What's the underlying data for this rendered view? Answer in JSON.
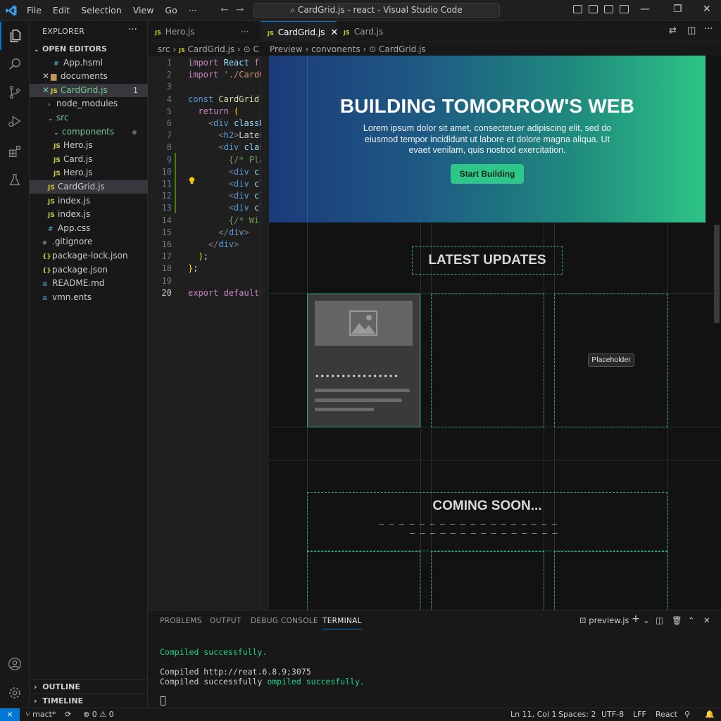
{
  "window": {
    "title": "CardGrid.js - react - Visual Studio Code",
    "menu": [
      "File",
      "Edit",
      "Selection",
      "View",
      "Go",
      "···"
    ]
  },
  "sidebar": {
    "title": "EXPLORER",
    "more": "···",
    "open_editors_label": "OPEN EDITORS",
    "rows": [
      {
        "label": "App.hsml",
        "kind": "css",
        "depth": 2
      },
      {
        "label": "documents",
        "kind": "folder",
        "depth": 1,
        "close": true
      },
      {
        "label": "CardGrid.js",
        "kind": "js",
        "depth": 1,
        "close": true,
        "selected": true,
        "badge": "1",
        "green": true
      },
      {
        "label": "node_modules",
        "kind": "chev",
        "depth": 1
      },
      {
        "label": "src",
        "kind": "chev-open",
        "depth": 1,
        "green": true
      },
      {
        "label": "components",
        "kind": "chev-open",
        "depth": 2,
        "green": true,
        "dot": true
      },
      {
        "label": "Hero.js",
        "kind": "js",
        "depth": 2
      },
      {
        "label": "Card.js",
        "kind": "js",
        "depth": 2
      },
      {
        "label": "Hero.js",
        "kind": "js",
        "depth": 2
      },
      {
        "label": "CardGrid.js",
        "kind": "js",
        "depth": 1,
        "selected": true
      },
      {
        "label": "index.js",
        "kind": "js",
        "depth": 1
      },
      {
        "label": "index.js",
        "kind": "js",
        "depth": 1
      },
      {
        "label": "App.css",
        "kind": "css",
        "depth": 1
      },
      {
        "label": ".gitignore",
        "kind": "git",
        "depth": 0
      },
      {
        "label": "package-lock.json",
        "kind": "json",
        "depth": 0
      },
      {
        "label": "package.json",
        "kind": "json",
        "depth": 0
      },
      {
        "label": "README.md",
        "kind": "md",
        "depth": 0
      },
      {
        "label": "vmn.ents",
        "kind": "md",
        "depth": 0
      }
    ],
    "outline_label": "OUTLINE",
    "timeline_label": "TIMELINE"
  },
  "editor": {
    "left_tab": "Hero.js",
    "left_more": "···",
    "tabs": [
      "CardGrid.js",
      "Card.js"
    ],
    "breadcrumb_left": [
      "src",
      "CardGrid.js",
      "C"
    ],
    "breadcrumb_right": [
      "Preview",
      "convonents",
      "CardGrid.js"
    ],
    "code": [
      {
        "n": "1",
        "html": "<span class='ctl'>import</span> <span class='attr'>React</span> <span class='ctl'>fr</span>"
      },
      {
        "n": "2",
        "html": "<span class='ctl'>import</span> <span class='str'>'./CardG</span>"
      },
      {
        "n": "3",
        "html": ""
      },
      {
        "n": "4",
        "html": "<span class='kw'>const</span> <span class='fn'>CardGrid</span>"
      },
      {
        "n": "5",
        "html": "  <span class='ctl'>return</span> <span class='br'>(</span>"
      },
      {
        "n": "6",
        "html": "    <span class='pn'>&lt;</span><span class='tag'>div</span> <span class='attr'>classN</span>"
      },
      {
        "n": "7",
        "html": "      <span class='pn'>&lt;</span><span class='tag'>h2</span><span class='pn'>&gt;</span><span class='pl'>Latest</span>"
      },
      {
        "n": "8",
        "html": "      <span class='pn'>&lt;</span><span class='tag'>div</span> <span class='attr'>class</span>"
      },
      {
        "n": "9",
        "html": "        <span class='cm'>{/* Plac</span>"
      },
      {
        "n": "10",
        "html": "        <span class='pn'>&lt;</span><span class='tag'>div</span> <span class='attr'>cla</span>"
      },
      {
        "n": "11",
        "html": "        <span class='pn'>&lt;</span><span class='tag'>div</span> <span class='attr'>cla</span>"
      },
      {
        "n": "12",
        "html": "        <span class='pn'>&lt;</span><span class='tag'>div</span> <span class='attr'>cla</span>"
      },
      {
        "n": "13",
        "html": "        <span class='pn'>&lt;</span><span class='tag'>div</span> <span class='attr'>cla</span>"
      },
      {
        "n": "14",
        "html": "        <span class='cm'>{/* Wire</span>"
      },
      {
        "n": "15",
        "html": "      <span class='pn'>&lt;/</span><span class='tag'>div</span><span class='pn'>&gt;</span>"
      },
      {
        "n": "16",
        "html": "    <span class='pn'>&lt;/</span><span class='tag'>div</span><span class='pn'>&gt;</span>"
      },
      {
        "n": "17",
        "html": "  <span class='br'>)</span><span class='pl'>;</span>"
      },
      {
        "n": "18",
        "html": "<span class='br'>}</span><span class='pl'>;</span>"
      },
      {
        "n": "19",
        "html": ""
      },
      {
        "n": "20",
        "html": "<span class='ctl'>export</span> <span class='ctl'>default</span>"
      },
      {
        "n": "21",
        "html": ""
      }
    ]
  },
  "preview": {
    "hero_title": "BUILDING TOMORROW'S WEB",
    "hero_text": "Lorem ipsum dolor sit amet, consectetuer adipiscing elit, sed do eiusmod tempor incidldunt ut labore et dolore magna aliqua. Ut evaet venilam, quis nostrod exercitation.",
    "hero_button": "Start Building",
    "section1_title": "LATEST UPDATES",
    "card_dots": "••••••••••••••••",
    "placeholder_chip": "Placeholder",
    "section2_title": "COMING SOON...",
    "dash_line_1": "— — — — — — — — — — — — — — — — — —",
    "dash_line_2": "— — — — — — — — — — — — — — —"
  },
  "panel": {
    "tabs": [
      "PROBLEMS",
      "OUTPUT",
      "DEBUG CONSOLE",
      "TERMINAL"
    ],
    "active_tab": "TERMINAL",
    "terminal_name": "preview.js",
    "term_line_1": "Compiled successfully.",
    "term_line_2": "Compiled http://reat.6.8.9;3075",
    "term_line_3a": "Compiled successfully ",
    "term_line_3b": "ompiled succesfully."
  },
  "statusbar": {
    "remote": "⨯",
    "branch": "mact*",
    "sync": "⟳",
    "problems": "⊗ 0 ⚠ 0",
    "position": "Ln 11, Col 1",
    "spaces": "Spaces: 2",
    "encoding": "UTF-8",
    "eol": "LFF",
    "language": "React"
  },
  "colors": {
    "accent": "#0078d4",
    "hero_start": "#1c3a7a",
    "hero_end": "#2ec486",
    "success": "#23d18b"
  }
}
